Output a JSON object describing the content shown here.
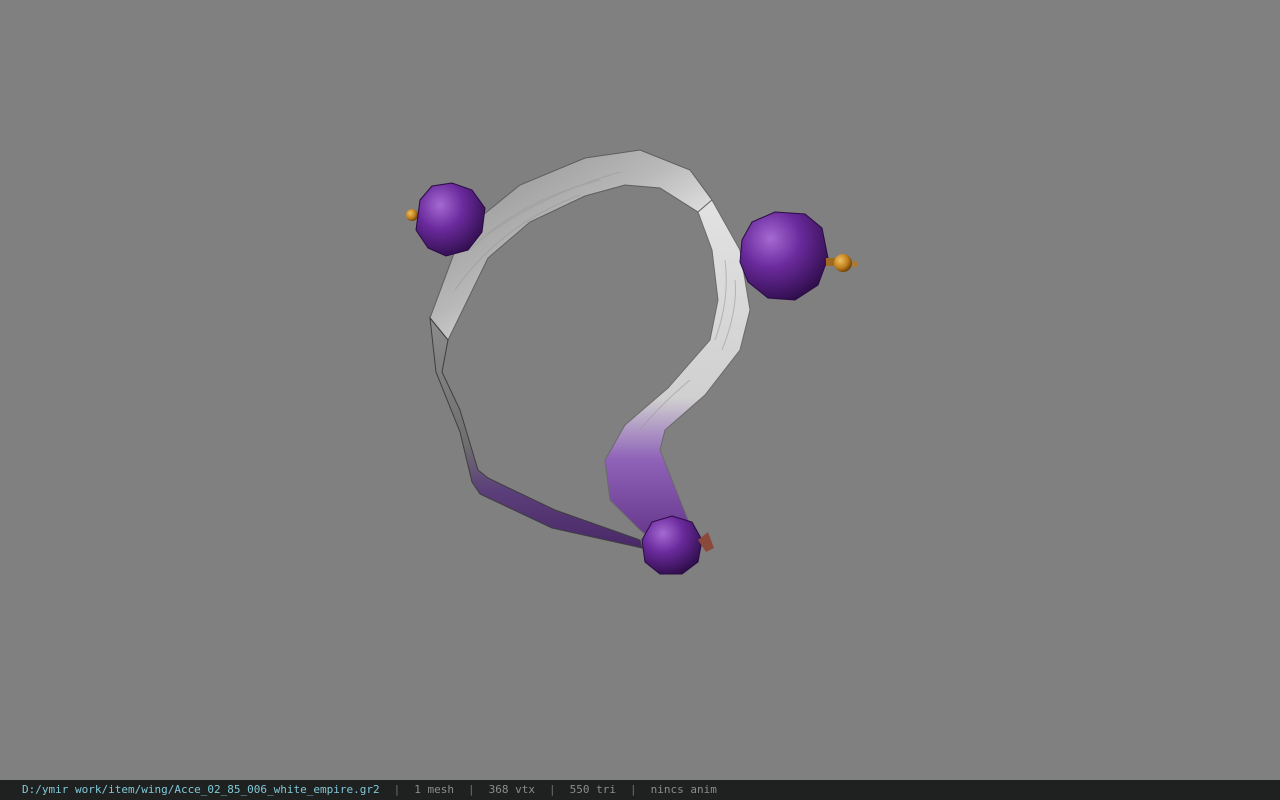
{
  "viewer": {
    "background_color": "#808080",
    "model_name": "Acce_02_85_006_white_empire",
    "model_colors": {
      "band_light": "#d8d8d8",
      "band_dark": "#6f6f6f",
      "band_purple": "#5a2a80",
      "bead_purple": "#5b1e8a",
      "bead_highlight": "#9a5bc8",
      "cap_gold": "#c88a2a"
    }
  },
  "statusbar": {
    "file_path": "D:/ymir work/item/wing/Acce_02_85_006_white_empire.gr2",
    "separator": "|",
    "mesh_count": "1 mesh",
    "vertex_count": "368 vtx",
    "triangle_count": "550 tri",
    "anim_status": "nincs anim"
  }
}
